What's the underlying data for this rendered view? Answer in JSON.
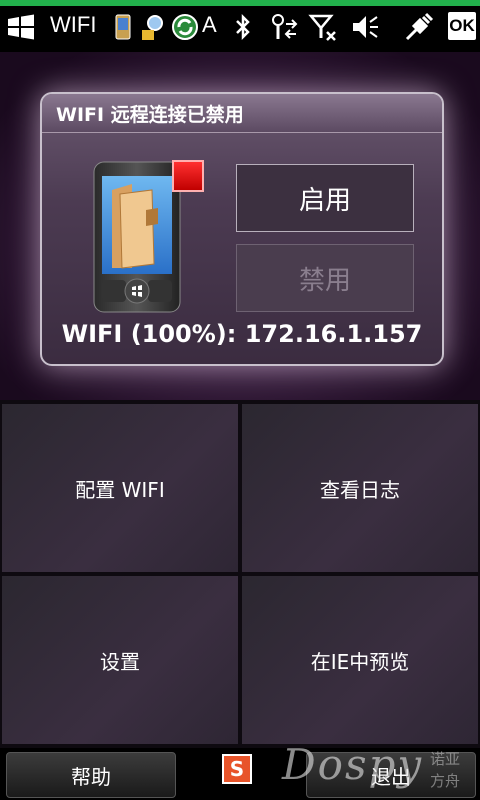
{
  "status_bar": {
    "app_title": "WIFI",
    "title_truncated": "A",
    "battery_fill_fraction": 1.0,
    "ok_label": "OK",
    "icons": [
      "windows-logo-icon",
      "phone-icon",
      "search-icon",
      "sync-icon",
      "bluetooth-icon",
      "signal-transfer-icon",
      "no-signal-icon",
      "mute-icon",
      "usb-plug-icon"
    ]
  },
  "panel": {
    "title": "WIFI 远程连接已禁用",
    "enable_label": "启用",
    "disable_label": "禁用",
    "status_text": "WIFI (100%): 172.16.1.157"
  },
  "tiles": {
    "configure_wifi": "配置 WIFI",
    "view_log": "查看日志",
    "settings": "设置",
    "preview_ie": "在IE中预览"
  },
  "bottom_bar": {
    "help_label": "帮助",
    "exit_label": "退出",
    "sogou_glyph": "S",
    "watermark": "Dospy",
    "watermark_cn_line1": "诺亚",
    "watermark_cn_line2": "方舟"
  },
  "colors": {
    "indicator_red": "#e01010",
    "progress_green": "#22b14c"
  }
}
